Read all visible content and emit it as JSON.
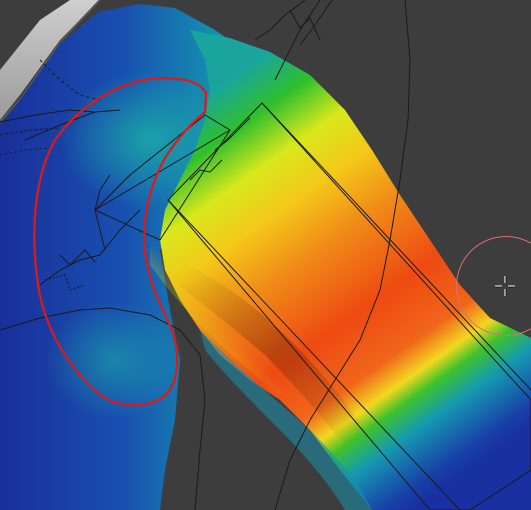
{
  "viewport": {
    "background": "#3d3d3d",
    "weight_colors": {
      "zero": "#1230a0",
      "low": "#0f8fb0",
      "mid": "#2fc02a",
      "high": "#f0e020",
      "full": "#e83a10"
    },
    "stroke_color": "#e01818",
    "brush_ring_color": "#d87070",
    "wire_color": "#1a1a1a"
  },
  "brush_cursor": {
    "icon": "crosshair-icon"
  }
}
